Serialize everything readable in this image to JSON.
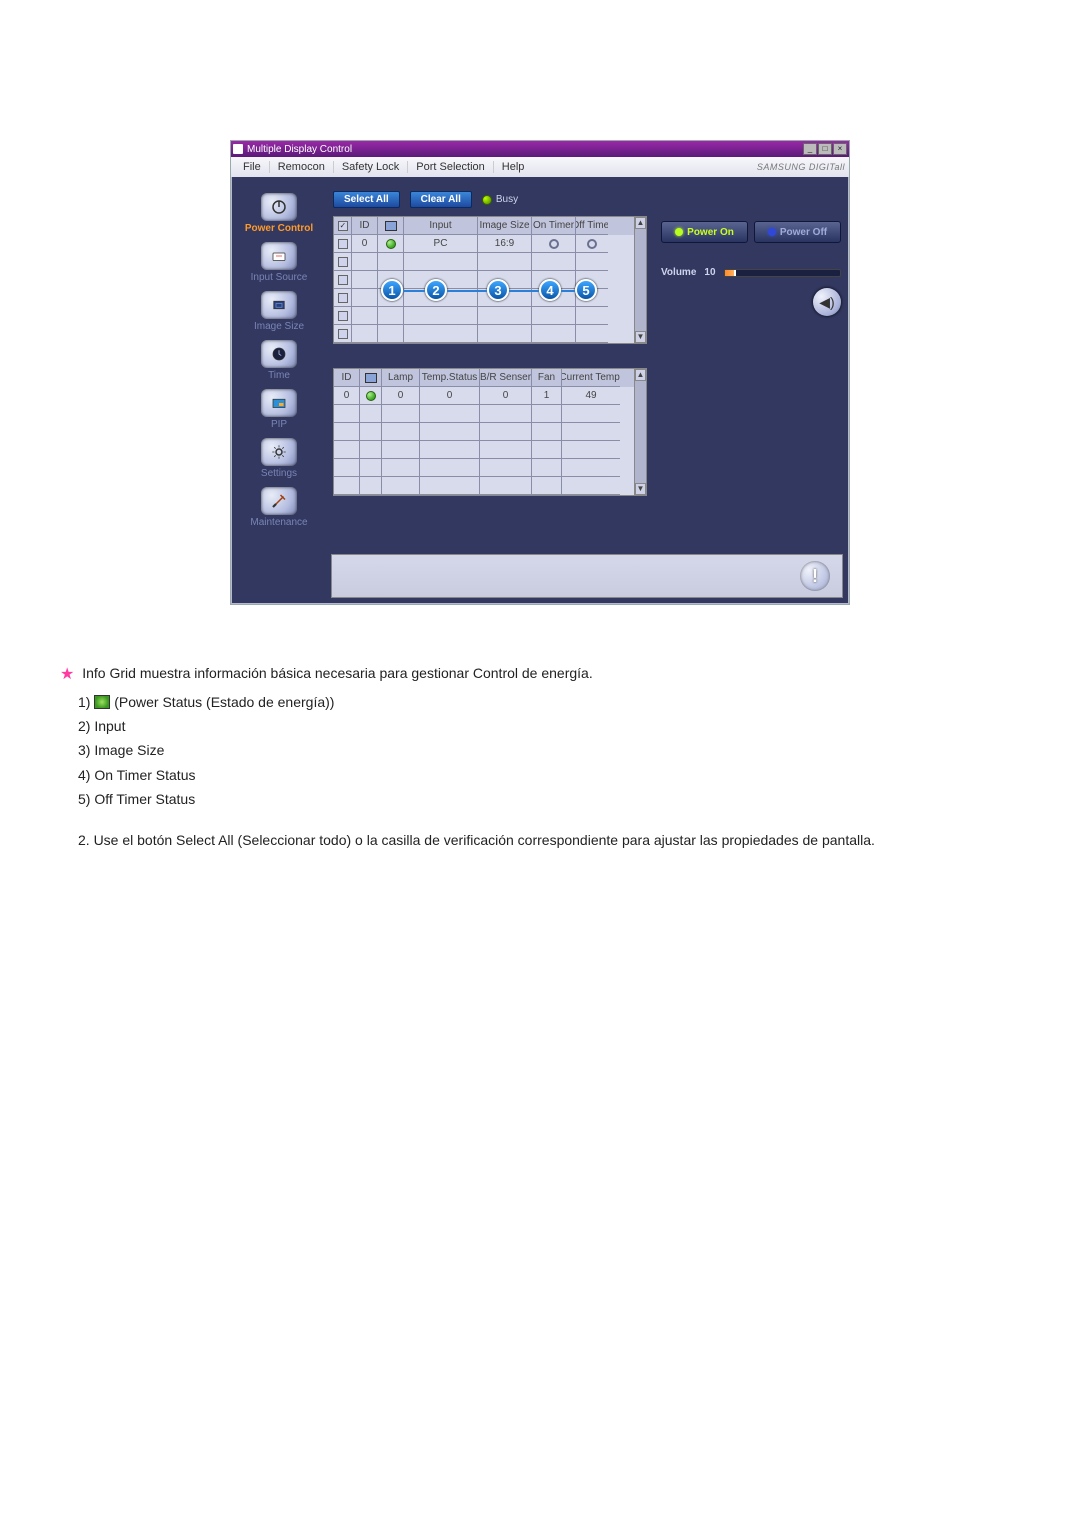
{
  "window": {
    "title": "Multiple Display Control"
  },
  "menu": {
    "file": "File",
    "remocon": "Remocon",
    "safety": "Safety Lock",
    "port": "Port Selection",
    "help": "Help",
    "brand": "SAMSUNG DIGITall"
  },
  "sidebar": {
    "items": [
      {
        "label": "Power Control"
      },
      {
        "label": "Input Source"
      },
      {
        "label": "Image Size"
      },
      {
        "label": "Time"
      },
      {
        "label": "PIP"
      },
      {
        "label": "Settings"
      },
      {
        "label": "Maintenance"
      }
    ]
  },
  "topbar": {
    "select_all": "Select All",
    "clear_all": "Clear All",
    "busy": "Busy"
  },
  "grid1": {
    "headers": {
      "id": "ID",
      "input": "Input",
      "image": "Image Size",
      "ontimer": "On Timer",
      "offtimer": "Off Timer"
    },
    "row0": {
      "id": "0",
      "input": "PC",
      "image": "16:9"
    }
  },
  "grid2": {
    "headers": {
      "id": "ID",
      "lamp": "Lamp",
      "temp": "Temp.Status",
      "bsensor": "B/R Senser",
      "fan": "Fan",
      "ctemp": "Current Temp."
    },
    "row0": {
      "id": "0",
      "lamp": "0",
      "temp": "0",
      "bsensor": "0",
      "fan": "1",
      "ctemp": "49"
    }
  },
  "annotations": {
    "a1": "1",
    "a2": "2",
    "a3": "3",
    "a4": "4",
    "a5": "5"
  },
  "right": {
    "power_on": "Power On",
    "power_off": "Power Off",
    "volume_label": "Volume",
    "volume_value": "10"
  },
  "desc": {
    "intro": "Info Grid muestra información básica necesaria para gestionar Control de energía.",
    "i1_pre": "1) ",
    "i1_post": " (Power Status (Estado de energía))",
    "i2": "2) Input",
    "i3": "3) Image Size",
    "i4": "4) On Timer Status",
    "i5": "5) Off Timer Status",
    "p2": "2.  Use el botón Select All (Seleccionar todo) o la casilla de verificación correspondiente para ajustar las propiedades de pantalla."
  }
}
